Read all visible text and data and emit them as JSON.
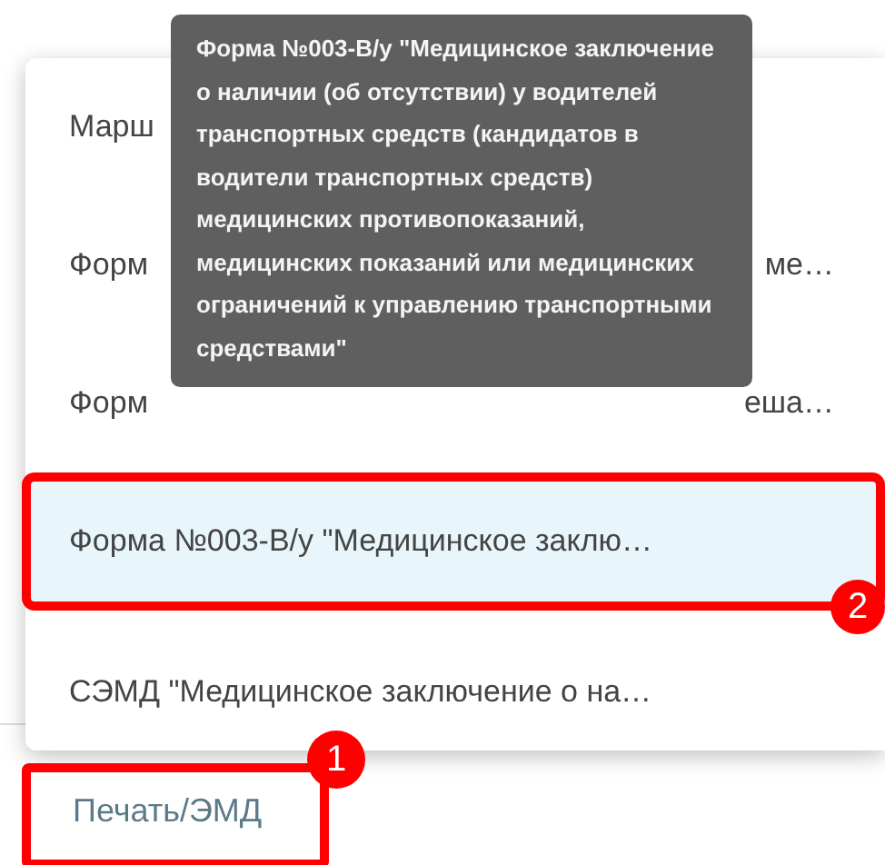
{
  "menu": {
    "items": [
      {
        "text": "Марш",
        "selected": false
      },
      {
        "text": "Форм",
        "tail": "ме…",
        "selected": false
      },
      {
        "text": "Форм",
        "tail": "еша…",
        "selected": false
      },
      {
        "text": "Форма №003-В/у \"Медицинское заклю…",
        "selected": true,
        "callout": "2"
      },
      {
        "text": "СЭМД \"Медицинское заключение о на…",
        "selected": false
      }
    ]
  },
  "tooltip": "Форма №003-В/у \"Медицинское заключение о наличии (об отсутствии) у водителей транспортных средств (кандидатов в водители транспортных средств) медицинских противопоказаний, медицинских показаний или медицинских ограничений к управлению транспортными средствами\"",
  "print_button": {
    "label": "Печать/ЭМД",
    "callout": "1"
  }
}
